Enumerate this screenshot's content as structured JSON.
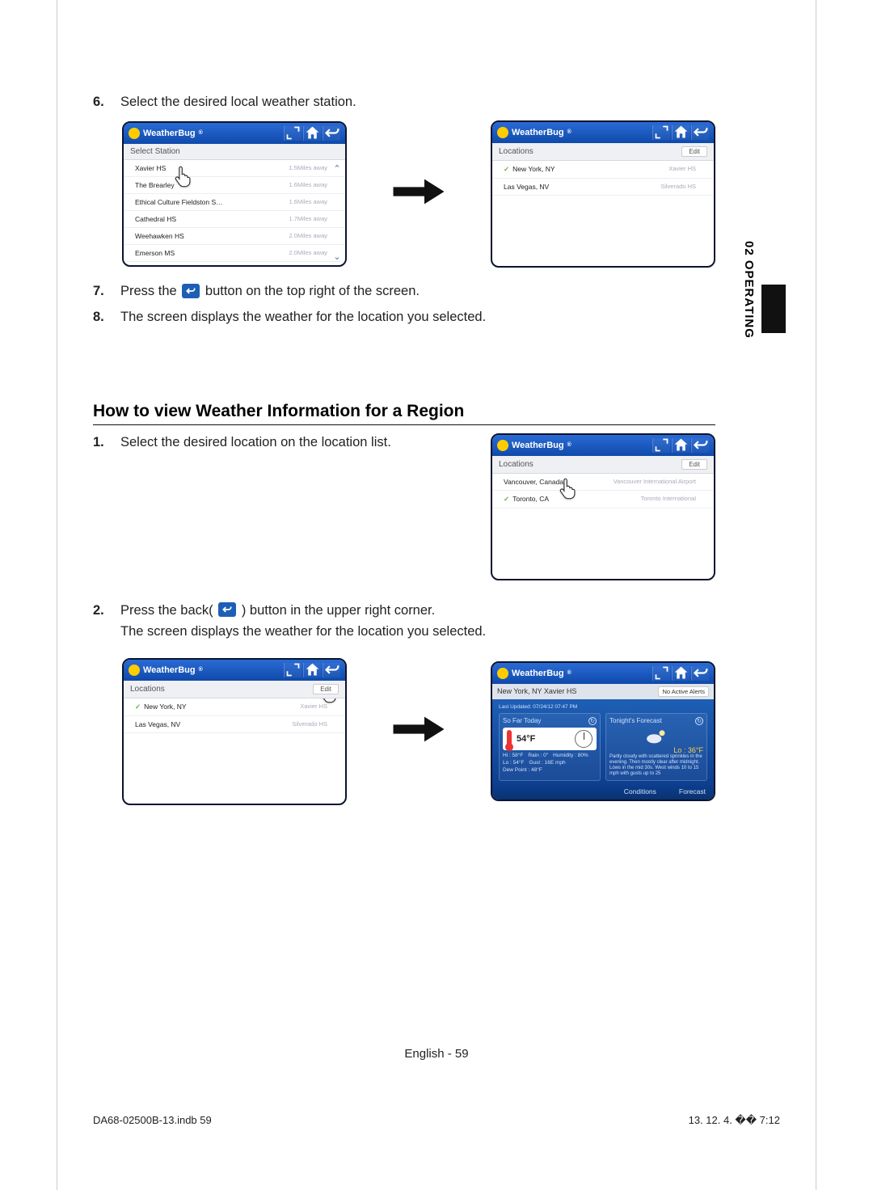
{
  "sideTab": "02  OPERATING",
  "steps6_8": {
    "s6": {
      "num": "6.",
      "text": "Select the desired local weather station."
    },
    "s7": {
      "num": "7.",
      "text_a": "Press the ",
      "text_b": " button on the top right of the screen."
    },
    "s8": {
      "num": "8.",
      "text": "The screen displays the weather for the location you selected."
    }
  },
  "screenA": {
    "brand": "WeatherBug",
    "sub": "Select Station",
    "rows": [
      {
        "loc": "Xavier HS",
        "meta": "1.5Miles away"
      },
      {
        "loc": "The Brearley",
        "meta": "1.6Miles away"
      },
      {
        "loc": "Ethical Culture Fieldston S…",
        "meta": "1.6Miles away"
      },
      {
        "loc": "Cathedral HS",
        "meta": "1.7Miles away"
      },
      {
        "loc": "Weehawken HS",
        "meta": "2.0Miles away"
      },
      {
        "loc": "Emerson MS",
        "meta": "2.0Miles away"
      }
    ]
  },
  "screenB": {
    "brand": "WeatherBug",
    "sub": "Locations",
    "edit": "Edit",
    "rows": [
      {
        "check": true,
        "loc": "New York, NY",
        "meta": "Xavier HS"
      },
      {
        "check": false,
        "loc": "Las Vegas, NV",
        "meta": "Silverado HS"
      }
    ]
  },
  "sectionTitle": "How to view Weather Information for a Region",
  "region": {
    "s1": {
      "num": "1.",
      "text": "Select the desired location on the location list."
    },
    "s2": {
      "num": "2.",
      "text_a": "Press the back( ",
      "text_b": " ) button in the upper right corner.",
      "text_c": "The screen displays the weather for the location you selected."
    }
  },
  "screenC": {
    "brand": "WeatherBug",
    "sub": "Locations",
    "edit": "Edit",
    "rows": [
      {
        "check": false,
        "loc": "Vancouver, Canada",
        "meta": "Vancouver International Airport"
      },
      {
        "check": true,
        "loc": "Toronto, CA",
        "meta": "Toronto International"
      }
    ]
  },
  "screenD": {
    "brand": "WeatherBug",
    "sub": "Locations",
    "edit": "Edit",
    "rows": [
      {
        "check": true,
        "loc": "New York, NY",
        "meta": "Xavier HS"
      },
      {
        "check": false,
        "loc": "Las Vegas, NV",
        "meta": "Silverado HS"
      }
    ]
  },
  "screenE": {
    "brand": "WeatherBug",
    "locbar": "New York, NY Xavier HS",
    "alerts": "No Active Alerts",
    "updated": "Last Updated: 07/24/12 07:47 PM",
    "panel1": {
      "title": "So Far Today",
      "temp": "54°F",
      "stats": [
        "Hi : 58°F",
        "Rain : 0\"",
        "Humidity : 80%",
        "Lo : 54°F",
        "Gust : 16E mph",
        "Dew Point : 48°F"
      ]
    },
    "panel2": {
      "title": "Tonight's Forecast",
      "lo": "Lo : 36°F",
      "text": "Partly cloudy with scattered sprinkles in the evening. Then mostly clear after midnight. Lows in the mid 30s. West winds 10 to 15 mph with gusts up to 25"
    },
    "tabs": [
      "Conditions",
      "Forecast"
    ]
  },
  "footerCenter": "English - 59",
  "footerLeft": "DA68-02500B-13.indb   59",
  "footerRight": "13. 12. 4.   �� 7:12"
}
